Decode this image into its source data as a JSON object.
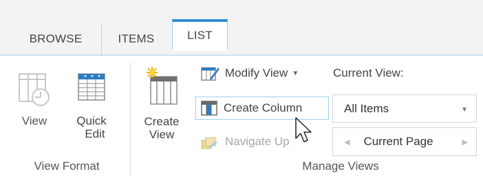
{
  "tabs": [
    {
      "label": "BROWSE",
      "active": false
    },
    {
      "label": "ITEMS",
      "active": false
    },
    {
      "label": "LIST",
      "active": true
    }
  ],
  "groups": {
    "view_format": {
      "label": "View Format",
      "buttons": [
        {
          "label": "View",
          "icon": "standard-view-icon"
        },
        {
          "label_line1": "Quick",
          "label_line2": "Edit",
          "icon": "quick-edit-grid-icon"
        }
      ]
    },
    "manage_views": {
      "label": "Manage Views",
      "create_view": {
        "label_line1": "Create",
        "label_line2": "View",
        "icon": "create-view-icon"
      },
      "modify_view": {
        "label": "Modify View",
        "icon": "modify-view-icon"
      },
      "create_column": {
        "label": "Create Column",
        "icon": "create-column-icon"
      },
      "navigate_up": {
        "label": "Navigate Up",
        "icon": "navigate-up-icon",
        "disabled": true
      },
      "current_view_label": "Current View:",
      "current_view_value": "All Items",
      "current_page": "Current Page"
    }
  },
  "colors": {
    "accent": "#2b8ed2",
    "tab_border": "#9cd0ee",
    "tab_bar_bg": "#f3f3f3"
  }
}
